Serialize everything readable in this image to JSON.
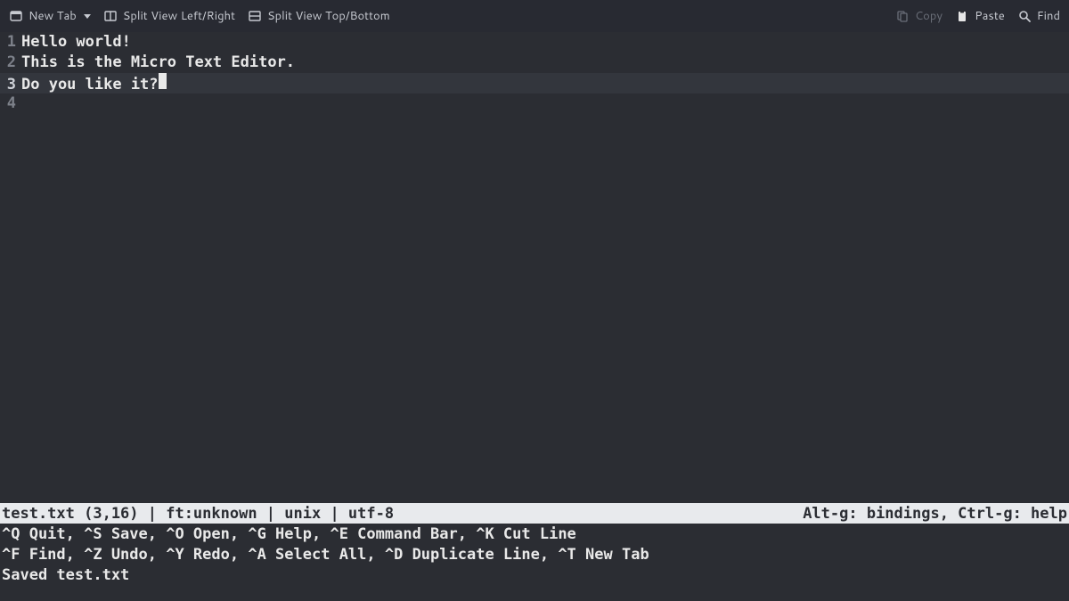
{
  "toolbar": {
    "new_tab_label": "New Tab",
    "split_lr_label": "Split View Left/Right",
    "split_tb_label": "Split View Top/Bottom",
    "copy_label": "Copy",
    "paste_label": "Paste",
    "find_label": "Find"
  },
  "editor": {
    "lines": [
      {
        "num": "1",
        "text": "Hello world!"
      },
      {
        "num": "2",
        "text": "This is the Micro Text Editor."
      },
      {
        "num": "3",
        "text": "Do you like it?"
      },
      {
        "num": "4",
        "text": ""
      }
    ],
    "current_line_index": 2
  },
  "status": {
    "left": "test.txt (3,16) | ft:unknown | unix | utf-8",
    "right": "Alt-g: bindings, Ctrl-g: help"
  },
  "help": {
    "line1": "^Q Quit, ^S Save, ^O Open, ^G Help, ^E Command Bar, ^K Cut Line",
    "line2": "^F Find, ^Z Undo, ^Y Redo, ^A Select All, ^D Duplicate Line, ^T New Tab"
  },
  "message": "Saved test.txt"
}
